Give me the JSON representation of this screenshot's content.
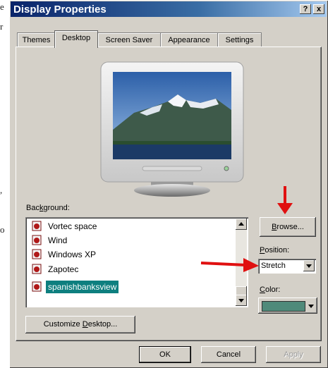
{
  "left_fragments": [
    "e",
    "r",
    ",",
    "o"
  ],
  "window": {
    "title": "Display Properties",
    "help_button": "?",
    "close_button": "x"
  },
  "tabs": [
    {
      "label": "Themes",
      "active": false
    },
    {
      "label": "Desktop",
      "active": true
    },
    {
      "label": "Screen Saver",
      "active": false
    },
    {
      "label": "Appearance",
      "active": false
    },
    {
      "label": "Settings",
      "active": false
    }
  ],
  "preview": {
    "description_icon": "monitor-preview-icon"
  },
  "background": {
    "label_pre": "Bac",
    "label_u": "k",
    "label_post": "ground:",
    "items": [
      {
        "label": "Vortec space",
        "selected": false
      },
      {
        "label": "Wind",
        "selected": false
      },
      {
        "label": "Windows XP",
        "selected": false
      },
      {
        "label": "Zapotec",
        "selected": false
      },
      {
        "label": "spanishbanksview",
        "selected": true
      }
    ]
  },
  "browse": {
    "label_u": "B",
    "label_rest": "rowse..."
  },
  "position": {
    "label_u": "P",
    "label_rest": "osition:",
    "value": "Stretch"
  },
  "color": {
    "label_u": "C",
    "label_rest": "olor:",
    "swatch": "#4f8a7a"
  },
  "customize": {
    "label_pre": "Customize ",
    "label_u": "D",
    "label_post": "esktop..."
  },
  "footer": {
    "ok": "OK",
    "cancel": "Cancel",
    "apply": "Apply"
  },
  "colors": {
    "title_bar": "#0a246a",
    "selection": "#0e7f7f",
    "annotation_arrow": "#e01010"
  }
}
